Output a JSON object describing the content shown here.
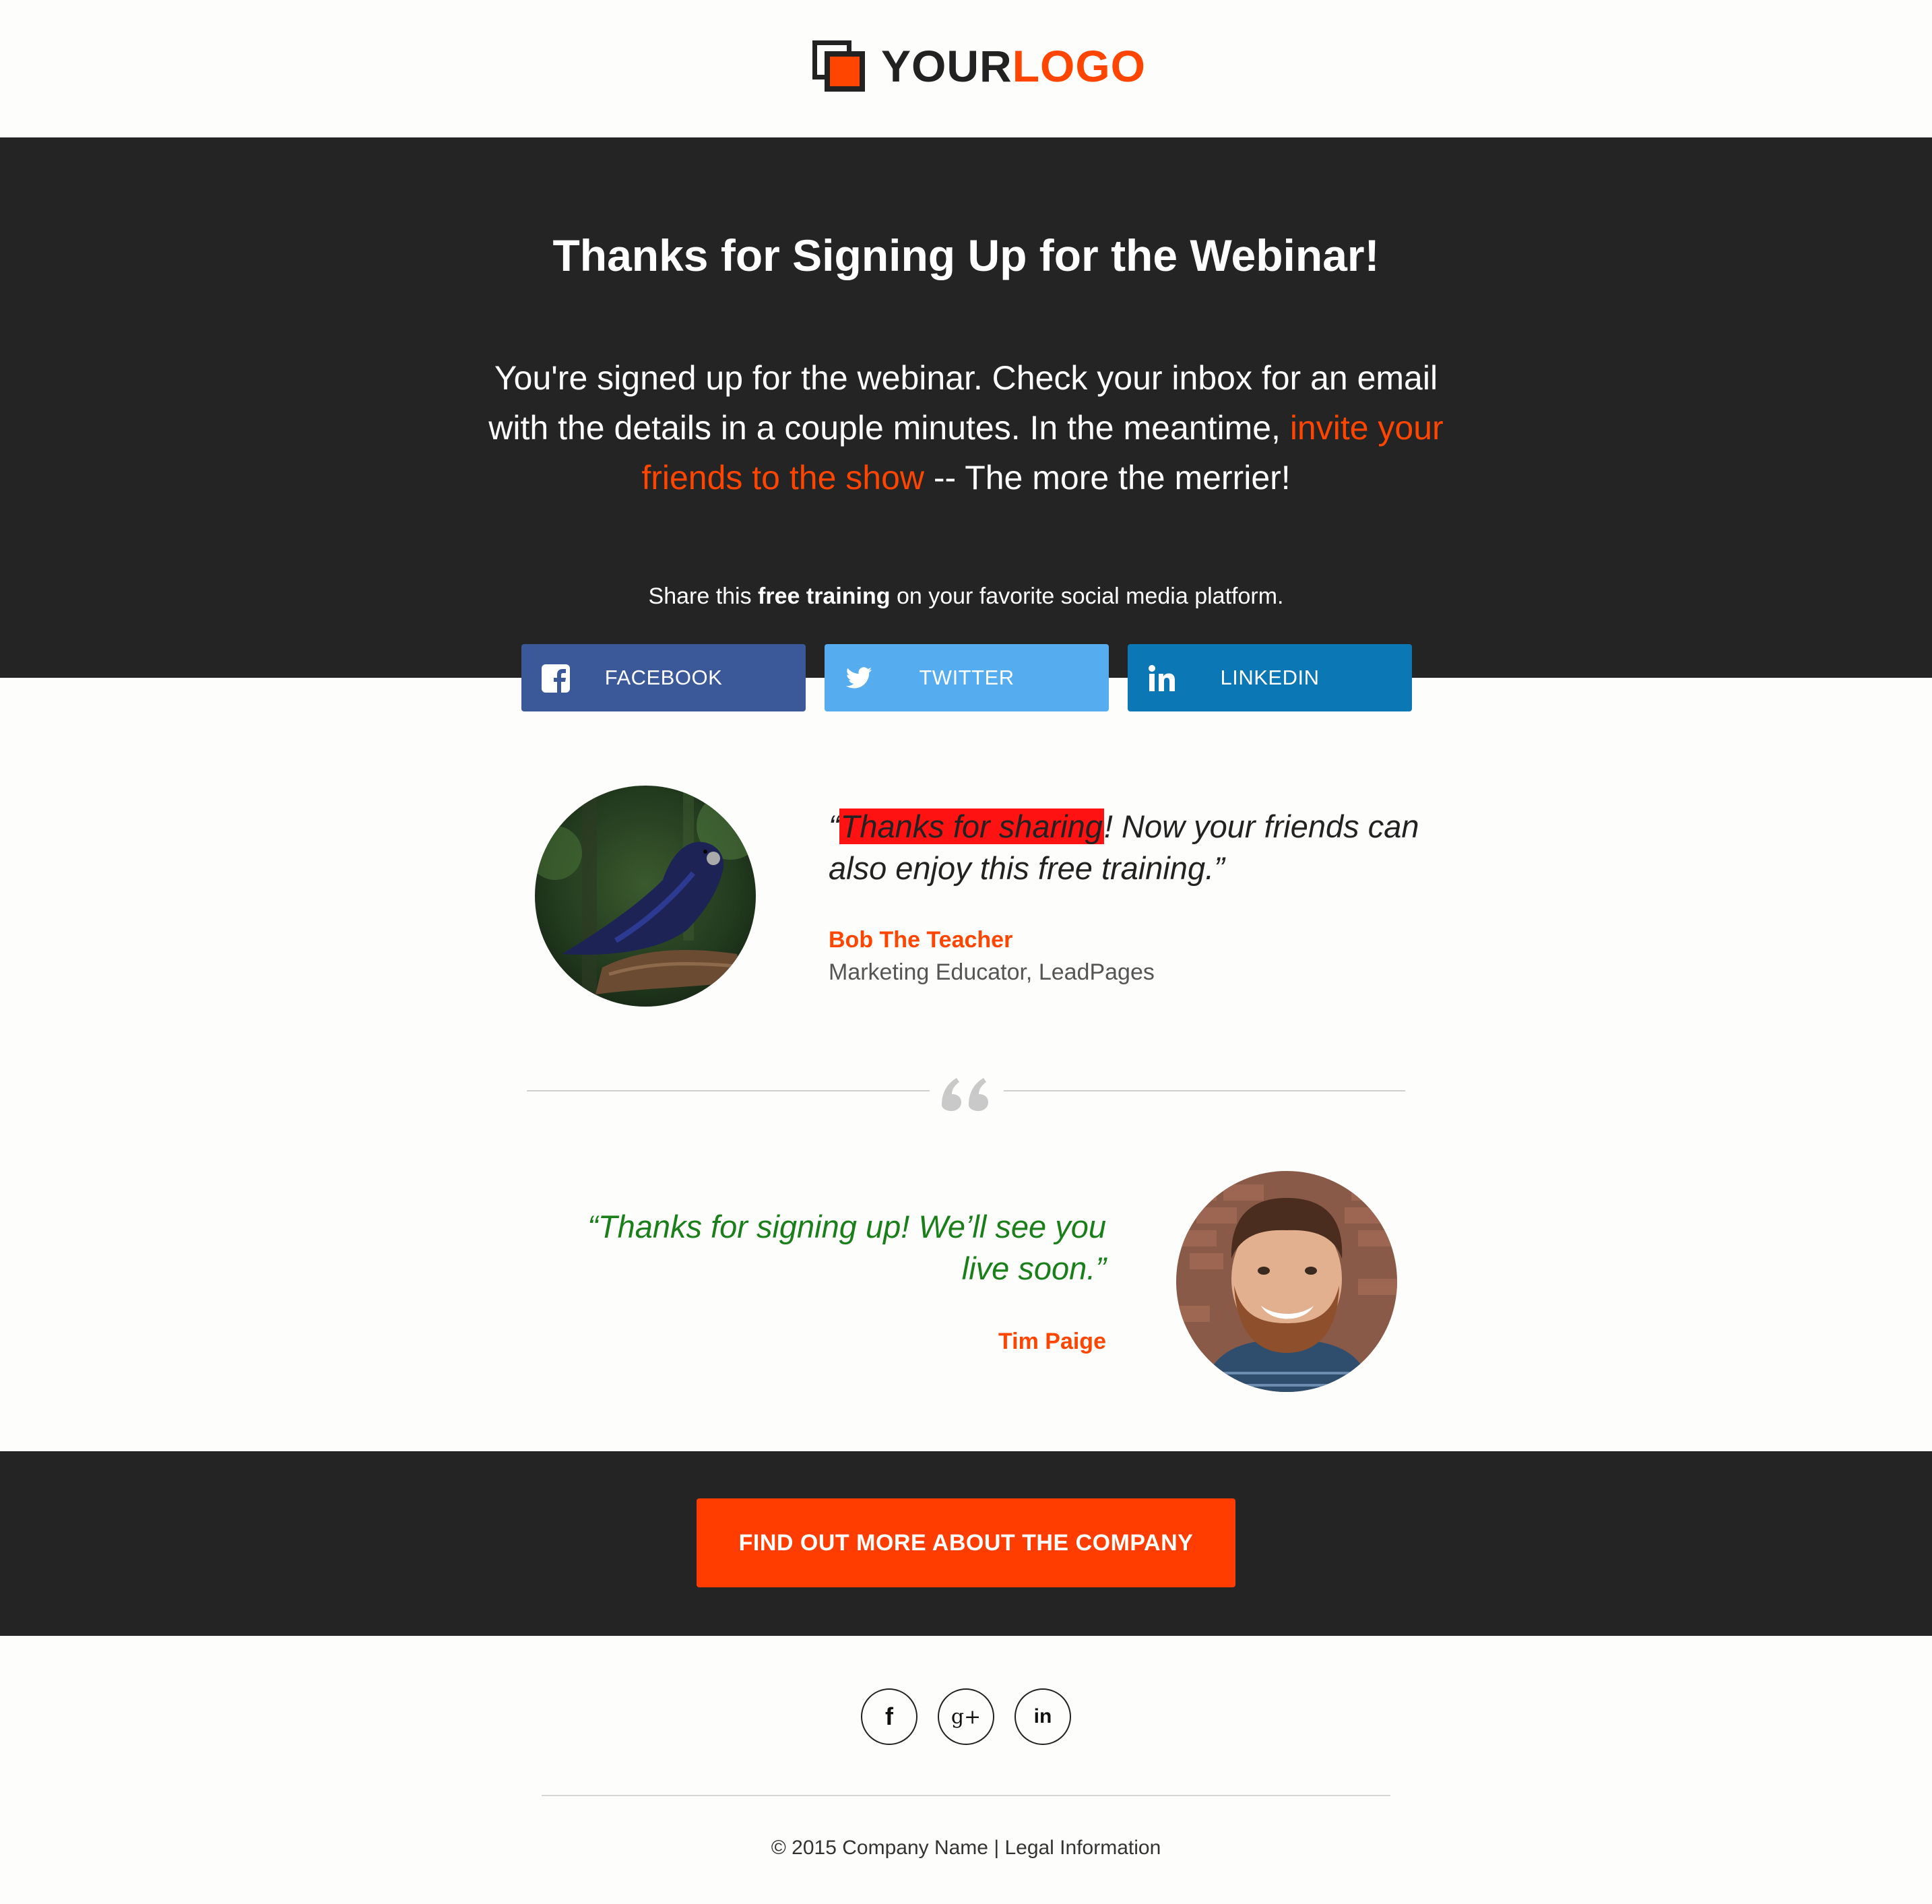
{
  "header": {
    "logo_your": "YOUR",
    "logo_logo": "LOGO"
  },
  "hero": {
    "title": "Thanks for Signing Up for the Webinar!",
    "body_before_link": "You're signed up for the webinar. Check your inbox for an email with the details in a couple minutes. In the meantime, ",
    "body_link": "invite your friends to the show",
    "body_after_link": " -- The more the merrier!",
    "share_before": "Share this ",
    "share_bold": "free training",
    "share_after": " on your favorite social media platform."
  },
  "social_buttons": [
    {
      "label": "FACEBOOK",
      "icon": "facebook-icon",
      "color": "#3b5998"
    },
    {
      "label": "TWITTER",
      "icon": "twitter-icon",
      "color": "#55acee"
    },
    {
      "label": "LINKEDIN",
      "icon": "linkedin-icon",
      "color": "#0b77b5"
    }
  ],
  "testimonials": [
    {
      "open_quote": "“",
      "highlight": "Thanks for sharing",
      "rest": "! Now your friends can also enjoy this free training.”",
      "name": "Bob The Teacher",
      "role": "Marketing Educator, LeadPages",
      "avatar": "bird-photo"
    },
    {
      "quote": "“Thanks for signing up! We’ll see you live soon.”",
      "name": "Tim Paige",
      "avatar": "man-photo"
    }
  ],
  "cta": {
    "label": "FIND OUT MORE ABOUT THE COMPANY"
  },
  "footer": {
    "icons": [
      "facebook-icon",
      "google-plus-icon",
      "linkedin-icon"
    ],
    "fb_glyph": "f",
    "gp_glyph": "g+",
    "li_glyph": "in",
    "copyright": "© 2015 Company Name | Legal Information"
  },
  "colors": {
    "accent": "#ff4500",
    "dark": "#242424",
    "highlight": "#ff1212",
    "quote_green": "#1a7f1a"
  }
}
